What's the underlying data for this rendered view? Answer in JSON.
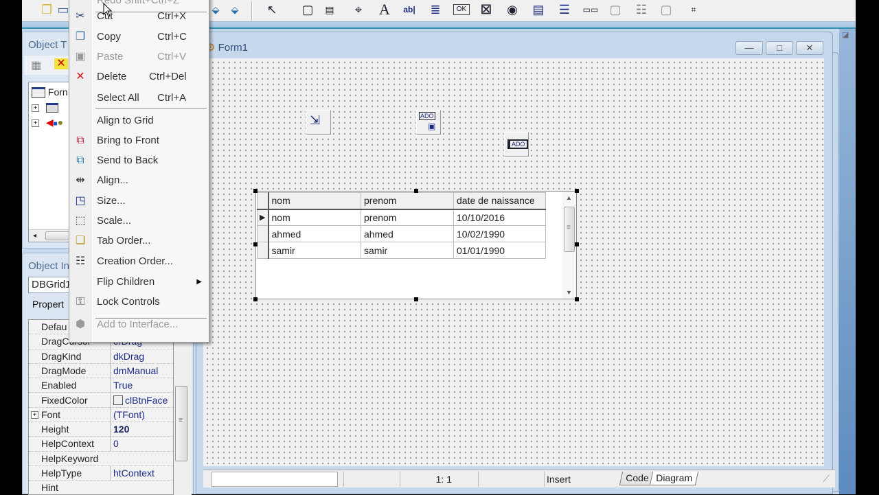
{
  "ide": {
    "accent_color": "#2c95b5",
    "toolbar_icons": [
      "new-items-icon",
      "open-icon",
      "step-into-icon",
      "step-over-icon",
      "pointer-icon",
      "frame-icon",
      "main-menu-icon",
      "popup-menu-icon",
      "label-icon",
      "edit-icon",
      "memo-icon",
      "button-icon",
      "checkbox-icon",
      "radiobutton-icon",
      "listbox-icon",
      "combobox-icon",
      "scrollbar-icon",
      "groupbox-icon",
      "radiogroup-icon",
      "panel-icon",
      "actionlist-icon"
    ]
  },
  "object_tree": {
    "title": "Object T",
    "root_label": "Forn",
    "children": [
      {
        "icon": "form-node-icon"
      },
      {
        "icon": "components-node-icon"
      }
    ]
  },
  "object_inspector": {
    "title": "Object In",
    "selected_component": "DBGrid1",
    "tab_label": "Propert",
    "properties": [
      {
        "name": "Defau",
        "value": ""
      },
      {
        "name": "DragCursor",
        "value": "crDrag"
      },
      {
        "name": "DragKind",
        "value": "dkDrag"
      },
      {
        "name": "DragMode",
        "value": "dmManual"
      },
      {
        "name": "Enabled",
        "value": "True"
      },
      {
        "name": "FixedColor",
        "value": "clBtnFace"
      },
      {
        "name": "Font",
        "value": "(TFont)"
      },
      {
        "name": "Height",
        "value": "120"
      },
      {
        "name": "HelpContext",
        "value": "0"
      },
      {
        "name": "HelpKeyword",
        "value": ""
      },
      {
        "name": "HelpType",
        "value": "htContext"
      },
      {
        "name": "Hint",
        "value": ""
      }
    ]
  },
  "form": {
    "title": "Form1",
    "window_buttons": {
      "minimize": "—",
      "maximize": "□",
      "close": "✕"
    },
    "components": [
      {
        "name": "DataSource",
        "icon": "datasource-icon"
      },
      {
        "name": "ADOConnection",
        "icon": "ado-connection-icon",
        "caption": "ADO"
      },
      {
        "name": "ADOTable",
        "icon": "ado-table-icon",
        "caption": "ADO"
      }
    ],
    "dbgrid": {
      "columns": [
        "nom",
        "prenom",
        "date de naissance"
      ],
      "rows": [
        [
          "nom",
          "prenom",
          "10/10/2016"
        ],
        [
          "ahmed",
          "ahmed",
          "10/02/1990"
        ],
        [
          "samir",
          "samir",
          "01/01/1990"
        ]
      ],
      "current_row_indicator": "▶"
    }
  },
  "statusbar": {
    "position": "1:   1",
    "mode": "Insert",
    "tabs": [
      "Code",
      "Diagram"
    ]
  },
  "context_menu": {
    "top_item": "Redo  Shift+Ctrl+Z",
    "items": [
      {
        "label": "Cut",
        "shortcut": "Ctrl+X",
        "icon": "scissors-icon",
        "enabled": true
      },
      {
        "label": "Copy",
        "shortcut": "Ctrl+C",
        "icon": "copy-icon",
        "enabled": true
      },
      {
        "label": "Paste",
        "shortcut": "Ctrl+V",
        "icon": "paste-icon",
        "enabled": false
      },
      {
        "label": "Delete",
        "shortcut": "Ctrl+Del",
        "icon": "delete-icon",
        "enabled": true
      },
      {
        "label": "Select All",
        "shortcut": "Ctrl+A",
        "icon": "",
        "enabled": true
      },
      {
        "label": "Align to Grid",
        "shortcut": "",
        "icon": "",
        "enabled": true
      },
      {
        "label": "Bring to Front",
        "shortcut": "",
        "icon": "bring-to-front-icon",
        "enabled": true
      },
      {
        "label": "Send to Back",
        "shortcut": "",
        "icon": "send-to-back-icon",
        "enabled": true
      },
      {
        "label": "Align...",
        "shortcut": "",
        "icon": "align-icon",
        "enabled": true
      },
      {
        "label": "Size...",
        "shortcut": "",
        "icon": "size-icon",
        "enabled": true
      },
      {
        "label": "Scale...",
        "shortcut": "",
        "icon": "scale-icon",
        "enabled": true
      },
      {
        "label": "Tab Order...",
        "shortcut": "",
        "icon": "tab-order-icon",
        "enabled": true
      },
      {
        "label": "Creation Order...",
        "shortcut": "",
        "icon": "creation-order-icon",
        "enabled": true
      },
      {
        "label": "Flip Children",
        "shortcut": "",
        "icon": "",
        "enabled": true,
        "submenu": true
      },
      {
        "label": "Lock Controls",
        "shortcut": "",
        "icon": "lock-controls-icon",
        "enabled": true
      },
      {
        "label": "Add to Interface...",
        "shortcut": "",
        "icon": "add-interface-icon",
        "enabled": false
      }
    ]
  }
}
